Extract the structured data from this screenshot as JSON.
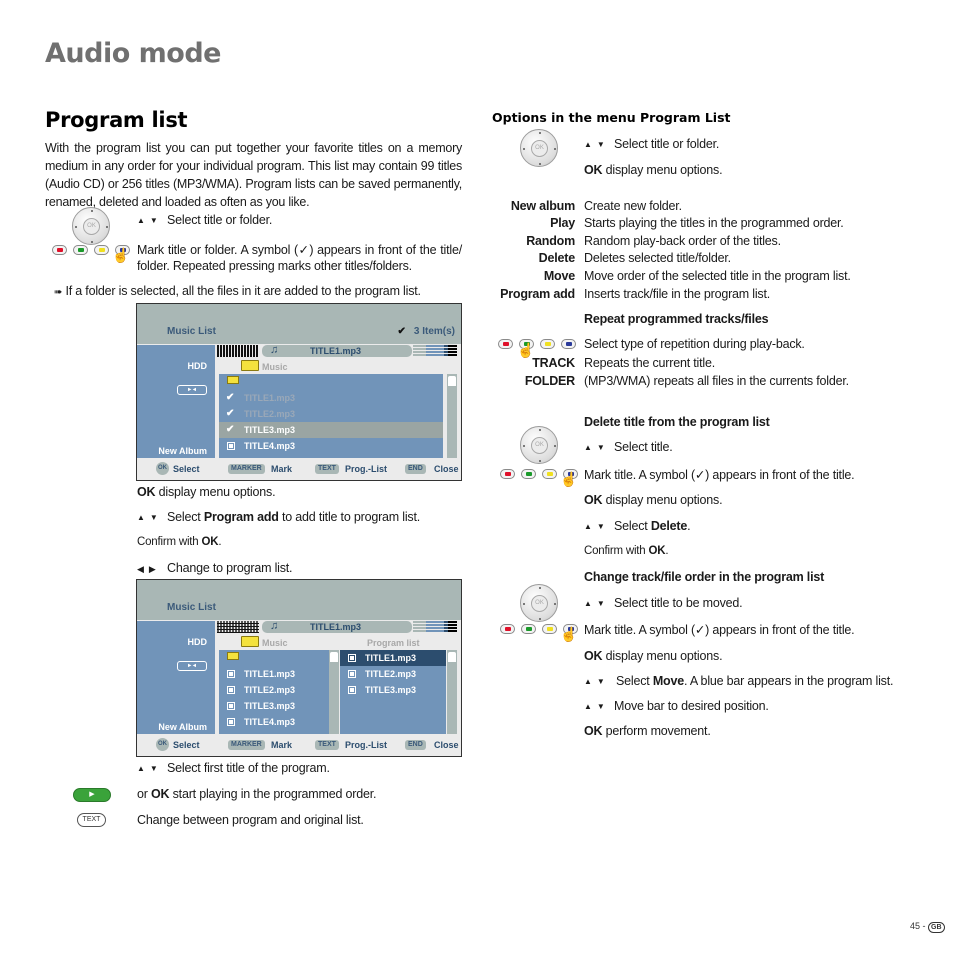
{
  "page": {
    "title": "Audio mode",
    "page_number": "45",
    "page_separator": " - ",
    "country_badge": "GB"
  },
  "left": {
    "section_title": "Program list",
    "intro": "With the program list you can put together your favorite titles on a memory medium in any order for your individual program. This list may contain 99 titles (Audio CD) or 256 titles (MP3/WMA). Program lists can be saved permanently, renamed, deleted and loaded as often as you like.",
    "step_select": "Select title or folder.",
    "step_mark": "Mark title or folder. A symbol (✓) appears in front of the title/ folder. Repeated pressing marks other titles/folders.",
    "note": "If a folder is selected, all the files in it are added to the program list.",
    "ok_menu_key": "OK",
    "ok_menu_text": " display menu options.",
    "select_pa_pre": "Select ",
    "select_pa_bold": "Program add",
    "select_pa_post": " to add title to program list.",
    "confirm_pre": "Confirm with ",
    "confirm_key": "OK",
    "confirm_post": ".",
    "change_list": "Change to program list.",
    "select_first": "Select first title of the program.",
    "or_ok_pre": "or ",
    "or_ok_key": "OK",
    "or_ok_post": " start playing in the programmed order.",
    "text_change": "Change between program and original list.",
    "play_button_glyph": "▶",
    "text_button_label": "TEXT"
  },
  "osd1": {
    "header": "Music List",
    "item_count": "3 Item(s)",
    "now_playing": "TITLE1.mp3",
    "source": "HDD",
    "album": "New Album",
    "folder": "Music",
    "rows": [
      {
        "name": "TITLE1.mp3",
        "marked": true,
        "dim": true
      },
      {
        "name": "TITLE2.mp3",
        "marked": true,
        "dim": true
      },
      {
        "name": "TITLE3.mp3",
        "marked": true,
        "selected": true
      },
      {
        "name": "TITLE4.mp3",
        "marked": false
      }
    ],
    "footer": [
      {
        "key": "OK",
        "label": "Select"
      },
      {
        "key": "MARKER",
        "label": "Mark"
      },
      {
        "key": "TEXT",
        "label": "Prog.-List"
      },
      {
        "key": "END",
        "label": "Close"
      }
    ]
  },
  "osd2": {
    "header": "Music List",
    "now_playing": "TITLE1.mp3",
    "source": "HDD",
    "album": "New Album",
    "folder": "Music",
    "program_header": "Program list",
    "rows": [
      "TITLE1.mp3",
      "TITLE2.mp3",
      "TITLE3.mp3",
      "TITLE4.mp3"
    ],
    "program_rows": [
      "TITLE1.mp3",
      "TITLE2.mp3",
      "TITLE3.mp3"
    ],
    "footer": [
      {
        "key": "OK",
        "label": "Select"
      },
      {
        "key": "MARKER",
        "label": "Mark"
      },
      {
        "key": "TEXT",
        "label": "Prog.-List"
      },
      {
        "key": "END",
        "label": "Close"
      }
    ]
  },
  "right": {
    "title": "Options in the menu Program List",
    "select": "Select title or folder.",
    "ok_key": "OK",
    "ok_text": " display menu options.",
    "options": [
      {
        "key": "New album",
        "desc": "Create new folder."
      },
      {
        "key": "Play",
        "desc": "Starts playing the titles in the programmed order."
      },
      {
        "key": "Random",
        "desc": "Random play-back order of the titles."
      },
      {
        "key": "Delete",
        "desc": "Deletes selected title/folder."
      },
      {
        "key": "Move",
        "desc": "Move order of the selected title in the program list."
      },
      {
        "key": "Program add",
        "desc": "Inserts track/file in the program list."
      }
    ],
    "repeat_title": "Repeat programmed tracks/files",
    "repeat_select": "Select type of repetition during play-back.",
    "repeat_opts": [
      {
        "key": "TRACK",
        "desc": "Repeats the current title."
      },
      {
        "key": "FOLDER",
        "desc": "(MP3/WMA) repeats all files in the currents folder."
      }
    ],
    "delete_title": "Delete title from the program list",
    "delete_select": "Select title.",
    "delete_mark": "Mark title. A symbol (✓) appears in front of the title.",
    "delete_ok_key": "OK",
    "delete_ok_text": " display menu options.",
    "delete_sel_pre": "Select ",
    "delete_sel_bold": "Delete",
    "delete_sel_post": ".",
    "delete_confirm_pre": "Confirm with ",
    "delete_confirm_key": "OK",
    "delete_confirm_post": ".",
    "move_title": "Change track/file order in the program list",
    "move_select": "Select title to be moved.",
    "move_mark": "Mark title. A symbol (✓) appears in front of the title.",
    "move_ok_key": "OK",
    "move_ok_text": " display menu options.",
    "move_sel_pre": "Select ",
    "move_sel_bold": "Move",
    "move_sel_post": ". A blue bar appears in the program list.",
    "move_bar": "Move bar to desired position.",
    "move_perform_key": "OK",
    "move_perform_text": " perform movement."
  },
  "colors": {
    "red_key": "#e0102a",
    "green_key": "#1a9a2a",
    "yellow_key": "#f0e020",
    "blue_key": "#2a3a9a",
    "osd_blue": "#7194b9",
    "osd_dark": "#2c4d6e",
    "osd_grey": "#a9b7b5"
  }
}
